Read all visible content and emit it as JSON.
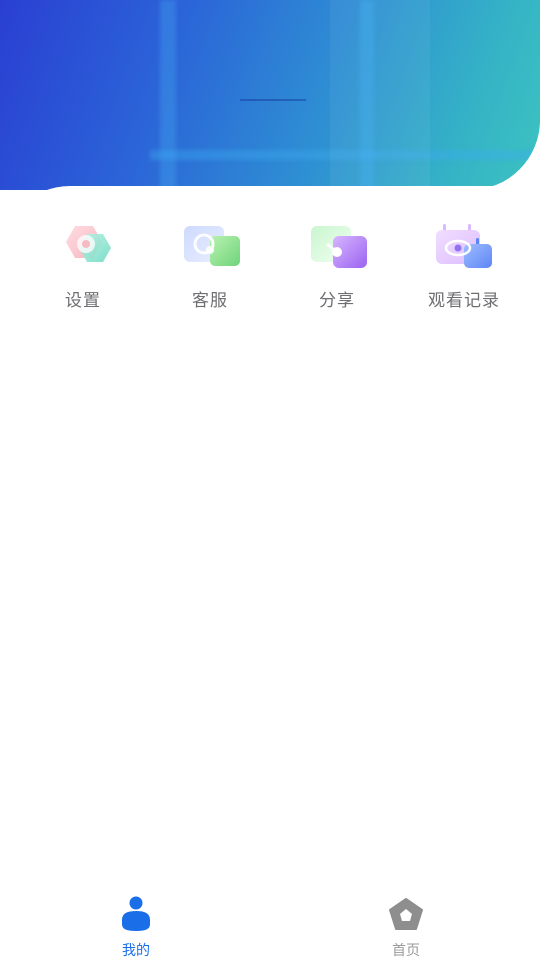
{
  "menu": {
    "items": [
      {
        "label": "设置",
        "icon": "settings-icon"
      },
      {
        "label": "客服",
        "icon": "customer-service-icon"
      },
      {
        "label": "分享",
        "icon": "share-icon"
      },
      {
        "label": "观看记录",
        "icon": "watch-history-icon"
      }
    ]
  },
  "tabbar": {
    "tabs": [
      {
        "label": "我的",
        "icon": "person-icon",
        "active": true,
        "color": "#1a6fe8"
      },
      {
        "label": "首页",
        "icon": "home-pentagon-icon",
        "active": false,
        "color": "#9a9a9a"
      }
    ]
  },
  "colors": {
    "header_gradient_start": "#2a3fd2",
    "header_gradient_end": "#3cc3c0",
    "accent": "#1a6fe8"
  }
}
